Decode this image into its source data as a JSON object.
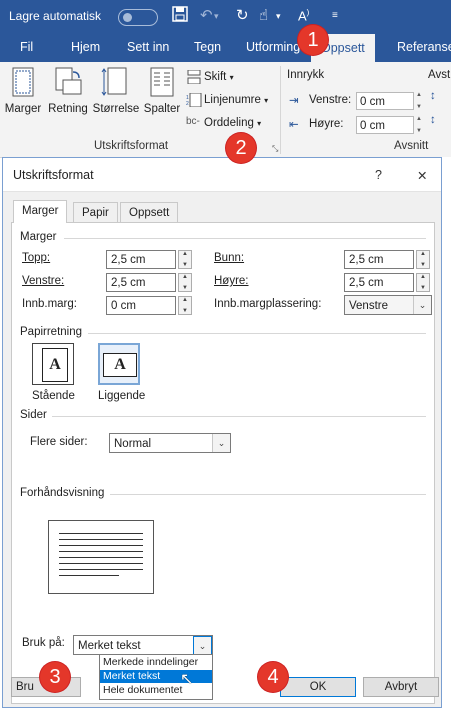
{
  "titlebar": {
    "autosave_label": "Lagre automatisk",
    "icons": [
      "save-icon",
      "undo-icon",
      "redo-icon",
      "touch-icon",
      "font-size-icon",
      "customize-icon"
    ]
  },
  "ribbon_tabs": [
    "Fil",
    "Hjem",
    "Sett inn",
    "Tegn",
    "Utforming",
    "Oppsett",
    "Referanser"
  ],
  "ribbon": {
    "buttons": [
      "Marger",
      "Retning",
      "Størrelse",
      "Spalter"
    ],
    "small": {
      "breaks": "Skift",
      "line_numbers": "Linjenumre",
      "hyphenation": "Orddeling"
    },
    "group_page_setup": "Utskriftsformat",
    "indent_title": "Innrykk",
    "spacing_title": "Avst",
    "indent_left_label": "Venstre:",
    "indent_left_value": "0 cm",
    "indent_right_label": "Høyre:",
    "indent_right_value": "0 cm",
    "group_paragraph": "Avsnitt"
  },
  "dialog": {
    "title": "Utskriftsformat",
    "help": "?",
    "close": "✕",
    "tabs": [
      "Marger",
      "Papir",
      "Oppsett"
    ],
    "margins_section": "Marger",
    "top_label": "Topp:",
    "top_value": "2,5 cm",
    "bottom_label": "Bunn:",
    "bottom_value": "2,5 cm",
    "left_label": "Venstre:",
    "left_value": "2,5 cm",
    "right_label": "Høyre:",
    "right_value": "2,5 cm",
    "gutter_label": "Innb.marg:",
    "gutter_value": "0 cm",
    "gutter_pos_label": "Innb.margplassering:",
    "gutter_pos_value": "Venstre",
    "orientation_section": "Papirretning",
    "portrait_label": "Stående",
    "landscape_label": "Liggende",
    "orient_glyph": "A",
    "pages_section": "Sider",
    "multiple_pages_label": "Flere sider:",
    "multiple_pages_value": "Normal",
    "preview_section": "Forhåndsvisning",
    "apply_to_label": "Bruk på:",
    "apply_to_value": "Merket tekst",
    "apply_to_options": [
      "Merkede inndelinger",
      "Merket tekst",
      "Hele dokumentet"
    ],
    "apply_to_selected_index": 1,
    "default_button": "Bru",
    "ok_button": "OK",
    "cancel_button": "Avbryt"
  },
  "badges": [
    "1",
    "2",
    "3",
    "4"
  ],
  "colors": {
    "ribbon_blue": "#2b579a",
    "badge_red": "#e4372a",
    "selection_blue": "#0078d7"
  }
}
